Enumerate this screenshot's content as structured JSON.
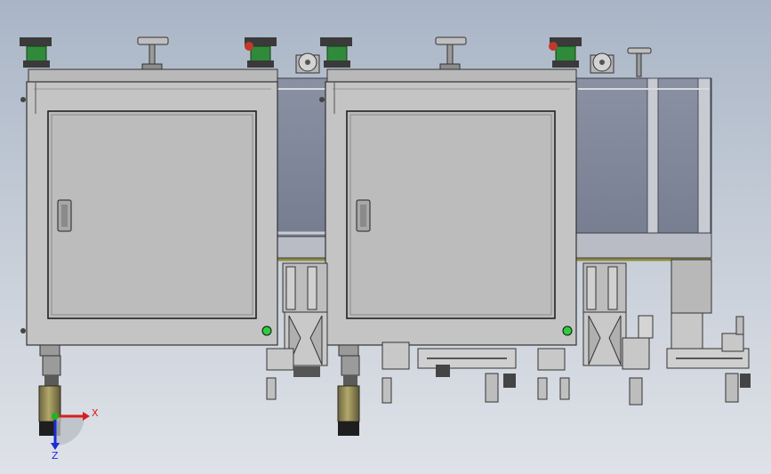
{
  "viewport": {
    "background_top": "#a9b5c6",
    "background_bottom": "#dfe2e8"
  },
  "model": {
    "cabinets": [
      {
        "id": "cabinet-left"
      },
      {
        "id": "cabinet-right"
      }
    ],
    "colors": {
      "cabinet_face": "#c4c4c4",
      "door_panel": "#bcbcbc",
      "frame_blue": "#7d8598",
      "foot_green": "#2f8a3a",
      "yellow_cylinder": "#9a8f55",
      "red_accent": "#c0392b"
    }
  },
  "triad": {
    "x_label": "X",
    "z_label": "Z",
    "x_color": "#d62020",
    "y_color": "#1fb51f",
    "z_color": "#1c2cd6"
  }
}
